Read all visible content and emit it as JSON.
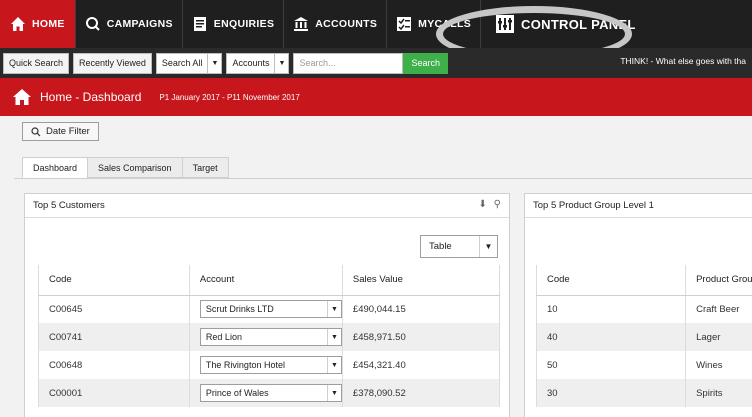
{
  "nav": {
    "home": "HOME",
    "campaigns": "CAMPAIGNS",
    "enquiries": "ENQUIRIES",
    "accounts": "ACCOUNTS",
    "mycalls": "MYCALLS",
    "control_panel": "CONTROL PANEL"
  },
  "toolbar": {
    "quick_search": "Quick Search",
    "recently_viewed": "Recently Viewed",
    "search_scope": "Search All",
    "search_type": "Accounts",
    "search_placeholder": "Search...",
    "search_button": "Search",
    "tagline": "THINK! - What else goes with tha"
  },
  "header": {
    "title": "Home - Dashboard",
    "period": "P1 January 2017 - P11 November 2017"
  },
  "date_filter": "Date Filter",
  "tabs": [
    "Dashboard",
    "Sales Comparison",
    "Target"
  ],
  "panel_left": {
    "title": "Top 5 Customers",
    "view": "Table",
    "columns": [
      "Code",
      "Account",
      "Sales Value"
    ],
    "rows": [
      {
        "code": "C00645",
        "account": "Scrut Drinks LTD",
        "value": "£490,044.15"
      },
      {
        "code": "C00741",
        "account": "Red Lion",
        "value": "£458,971.50"
      },
      {
        "code": "C00648",
        "account": "The Rivington Hotel",
        "value": "£454,321.40"
      },
      {
        "code": "C00001",
        "account": "Prince of Wales",
        "value": "£378,090.52"
      }
    ]
  },
  "panel_right": {
    "title": "Top 5 Product Group Level 1",
    "columns": [
      "Code",
      "Product Grou"
    ],
    "rows": [
      {
        "code": "10",
        "group": "Craft Beer"
      },
      {
        "code": "40",
        "group": "Lager"
      },
      {
        "code": "50",
        "group": "Wines"
      },
      {
        "code": "30",
        "group": "Spirits"
      }
    ]
  },
  "colors": {
    "brand_red": "#c8161d",
    "nav_bg": "#1f1f1f",
    "search_green": "#3db04a"
  }
}
